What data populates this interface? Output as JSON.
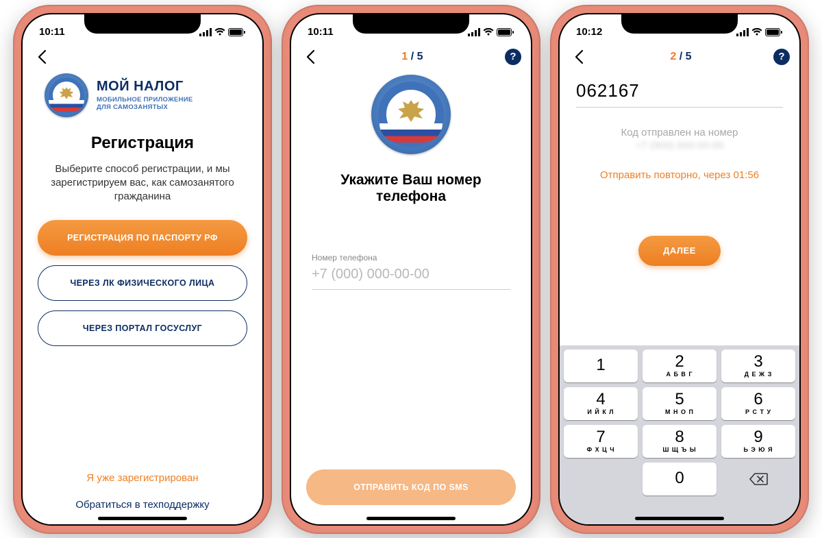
{
  "screen1": {
    "status_time": "10:11",
    "brand_title": "МОЙ НАЛОГ",
    "brand_subtitle_l1": "МОБИЛЬНОЕ ПРИЛОЖЕНИЕ",
    "brand_subtitle_l2": "ДЛЯ САМОЗАНЯТЫХ",
    "title": "Регистрация",
    "subtitle": "Выберите способ регистрации, и мы зарегистрируем вас, как самозанятого гражданина",
    "btn_passport": "РЕГИСТРАЦИЯ ПО ПАСПОРТУ РФ",
    "btn_lk": "ЧЕРЕЗ ЛК ФИЗИЧЕСКОГО ЛИЦА",
    "btn_gosuslugi": "ЧЕРЕЗ ПОРТАЛ ГОСУСЛУГ",
    "link_already": "Я уже зарегистрирован",
    "link_support": "Обратиться в техподдержку"
  },
  "screen2": {
    "status_time": "10:11",
    "step_current": "1",
    "step_sep": " / ",
    "step_total": "5",
    "help": "?",
    "title": "Укажите Ваш номер телефона",
    "phone_label": "Номер телефона",
    "phone_placeholder": "+7 (000) 000-00-00",
    "btn_send": "ОТПРАВИТЬ КОД ПО SMS"
  },
  "screen3": {
    "status_time": "10:12",
    "step_current": "2",
    "step_sep": " / ",
    "step_total": "5",
    "help": "?",
    "code_value": "062167",
    "sent_caption": "Код отправлен на номер",
    "sent_phone": "+7 (900) 000-00-00",
    "resend": "Отправить повторно, через 01:56",
    "btn_next": "ДАЛЕЕ",
    "keypad": [
      {
        "d": "1",
        "l": ""
      },
      {
        "d": "2",
        "l": "А Б В Г"
      },
      {
        "d": "3",
        "l": "Д Е Ж З"
      },
      {
        "d": "4",
        "l": "И Й К Л"
      },
      {
        "d": "5",
        "l": "М Н О П"
      },
      {
        "d": "6",
        "l": "Р С Т У"
      },
      {
        "d": "7",
        "l": "Ф Х Ц Ч"
      },
      {
        "d": "8",
        "l": "Ш Щ Ъ Ы"
      },
      {
        "d": "9",
        "l": "Ь Э Ю Я"
      },
      {
        "d": "0",
        "l": ""
      }
    ]
  }
}
